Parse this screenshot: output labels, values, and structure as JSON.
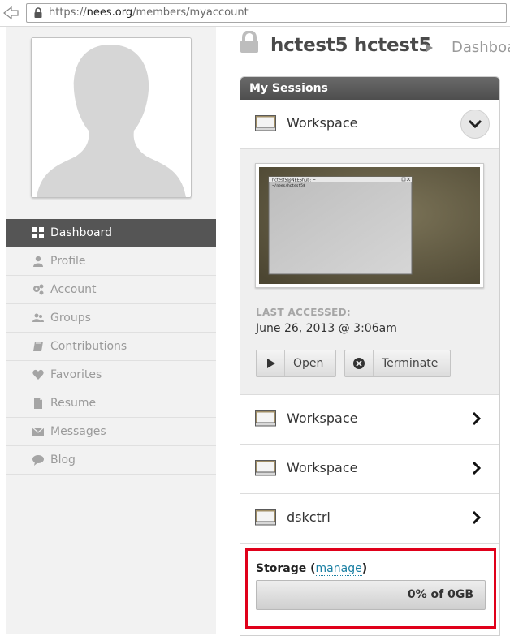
{
  "browser": {
    "url_prefix": "https://",
    "url_domain": "nees.org",
    "url_path": "/members/myaccount"
  },
  "profile": {
    "username": "hctest5 hctest5",
    "breadcrumb_current": "Dashboa"
  },
  "nav": {
    "items": [
      {
        "label": "Dashboard",
        "icon": "dashboard-grid-icon",
        "active": true
      },
      {
        "label": "Profile",
        "icon": "person-icon"
      },
      {
        "label": "Account",
        "icon": "gears-icon"
      },
      {
        "label": "Groups",
        "icon": "group-icon"
      },
      {
        "label": "Contributions",
        "icon": "book-icon"
      },
      {
        "label": "Favorites",
        "icon": "heart-icon"
      },
      {
        "label": "Resume",
        "icon": "document-icon"
      },
      {
        "label": "Messages",
        "icon": "envelope-icon"
      },
      {
        "label": "Blog",
        "icon": "speech-bubble-icon"
      }
    ]
  },
  "sessions": {
    "title": "My Sessions",
    "expanded": {
      "name": "Workspace",
      "last_accessed_label": "LAST ACCESSED:",
      "last_accessed_value": "June 26, 2013 @ 3:06am",
      "open_label": "Open",
      "terminate_label": "Terminate",
      "thumbnail_window_title": "hctest5@NEEShub: ~",
      "thumbnail_prompt": "~/nees/hctest5$"
    },
    "items": [
      {
        "name": "Workspace"
      },
      {
        "name": "Workspace"
      },
      {
        "name": "dskctrl"
      }
    ]
  },
  "storage": {
    "title": "Storage",
    "paren_open": " (",
    "manage_label": "manage",
    "paren_close": ")",
    "usage_text": "0% of 0GB",
    "usage_fraction": 0
  },
  "colors": {
    "active_nav": "#555555",
    "link": "#1a7fa3",
    "highlight": "#e0001a"
  }
}
